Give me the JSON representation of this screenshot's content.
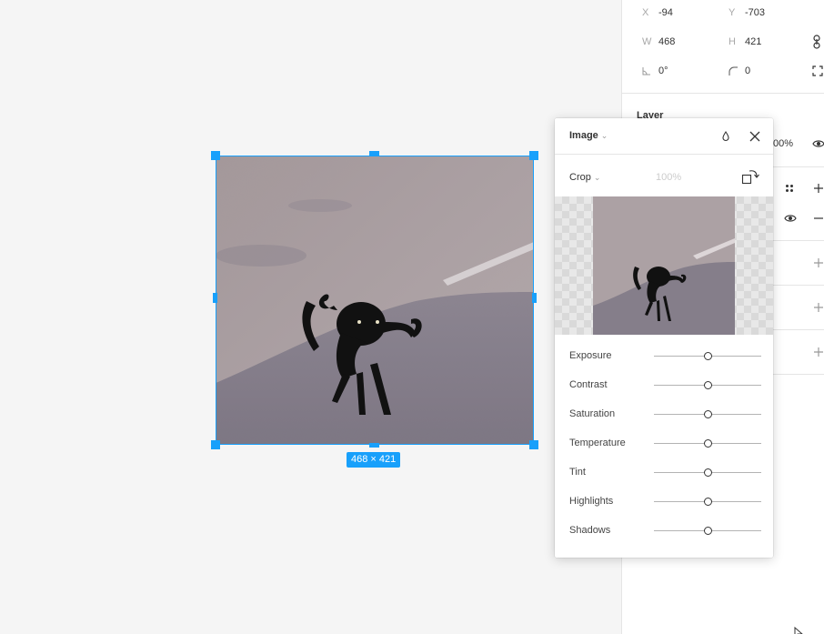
{
  "design": {
    "x": {
      "label": "X",
      "value": "-94"
    },
    "y": {
      "label": "Y",
      "value": "-703"
    },
    "w": {
      "label": "W",
      "value": "468"
    },
    "h": {
      "label": "H",
      "value": "421"
    },
    "rotation": {
      "value": "0°"
    },
    "corner_radius": {
      "value": "0"
    },
    "layer_title": "Layer",
    "opacity_partial": "00%",
    "icons": [
      "constrain-proportions-icon",
      "rotation-icon",
      "corner-radius-icon",
      "independent-corners-icon",
      "eye-icon",
      "styles-icon",
      "plus-icon",
      "minus-icon",
      "pointer-cursor-icon"
    ]
  },
  "canvas": {
    "size_badge": "468 × 421"
  },
  "image_panel": {
    "title": "Image",
    "crop_mode": "Crop",
    "zoom": "100%",
    "icons": [
      "chevron-down-icon",
      "water-drop-icon",
      "close-icon",
      "rotate-icon"
    ],
    "adjustments": [
      {
        "label": "Exposure",
        "value": 0.5
      },
      {
        "label": "Contrast",
        "value": 0.5
      },
      {
        "label": "Saturation",
        "value": 0.5
      },
      {
        "label": "Temperature",
        "value": 0.5
      },
      {
        "label": "Tint",
        "value": 0.5
      },
      {
        "label": "Highlights",
        "value": 0.5
      },
      {
        "label": "Shadows",
        "value": 0.5
      }
    ]
  },
  "colors": {
    "selection": "#18a0fb",
    "panel_bg": "#ffffff",
    "canvas_bg": "#f5f5f5"
  }
}
